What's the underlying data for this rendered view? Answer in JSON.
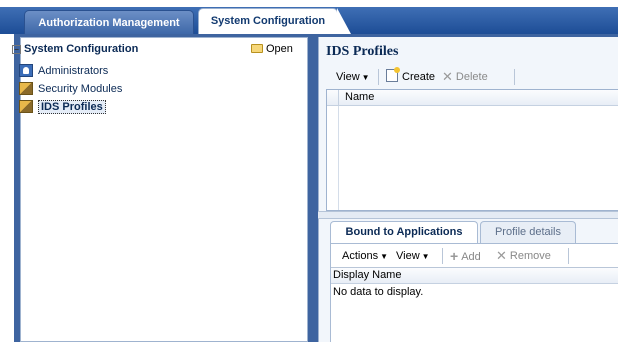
{
  "tabs": {
    "authorization": "Authorization Management",
    "system_configuration": "System Configuration"
  },
  "left_panel": {
    "root_label": "System Configuration",
    "root_twist": "−",
    "open_label": "Open",
    "items": [
      {
        "label": "Administrators",
        "icon": "administrator-icon"
      },
      {
        "label": "Security Modules",
        "icon": "security-module-icon"
      },
      {
        "label": "IDS Profiles",
        "icon": "ids-profile-icon",
        "selected": true
      }
    ]
  },
  "ids_profiles": {
    "title": "IDS Profiles",
    "toolbar": {
      "view_label": "View",
      "create_label": "Create",
      "delete_label": "Delete"
    },
    "table": {
      "columns": [
        "Name"
      ],
      "rows": []
    }
  },
  "detail_tabs": {
    "bound_label": "Bound to Applications",
    "profile_label": "Profile details"
  },
  "bound_apps": {
    "toolbar": {
      "actions_label": "Actions",
      "view_label": "View",
      "add_label": "Add",
      "remove_label": "Remove"
    },
    "table": {
      "columns": [
        "Display Name"
      ],
      "empty_message": "No data to display."
    }
  },
  "colors": {
    "header_blue": "#1d4d96",
    "frame_blue": "#3e64a0",
    "text_navy": "#0b2a55"
  }
}
